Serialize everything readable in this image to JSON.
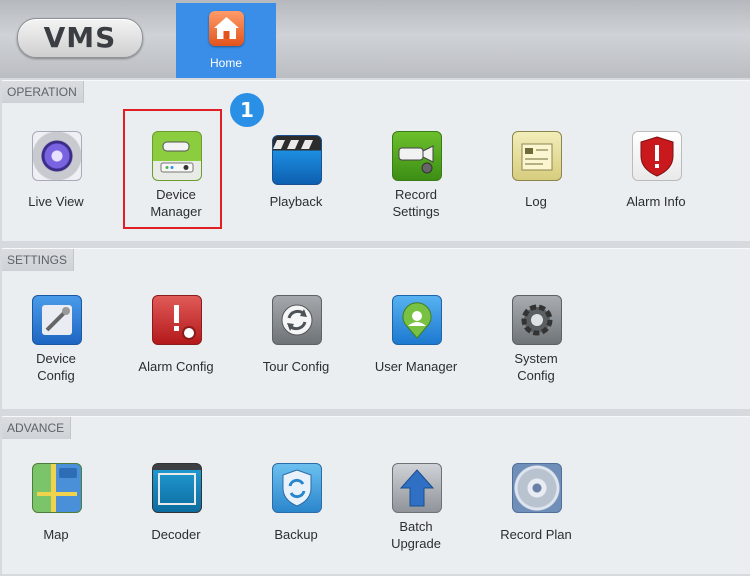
{
  "app": {
    "logo": "VMS"
  },
  "tabs": [
    {
      "label": "Home",
      "icon": "house-icon",
      "active": true
    }
  ],
  "sections": {
    "operation": {
      "title": "OPERATION",
      "items": [
        {
          "label": "Live View",
          "icon": "camera-lens-icon"
        },
        {
          "label": "Device\nManager",
          "icon": "device-manager-icon",
          "highlighted": true
        },
        {
          "label": "Playback",
          "icon": "clapperboard-icon"
        },
        {
          "label": "Record\nSettings",
          "icon": "record-settings-icon"
        },
        {
          "label": "Log",
          "icon": "log-book-icon"
        },
        {
          "label": "Alarm Info",
          "icon": "alarm-shield-icon"
        }
      ]
    },
    "settings": {
      "title": "SETTINGS",
      "items": [
        {
          "label": "Device\nConfig",
          "icon": "device-config-icon"
        },
        {
          "label": "Alarm Config",
          "icon": "alarm-config-icon"
        },
        {
          "label": "Tour Config",
          "icon": "tour-refresh-icon"
        },
        {
          "label": "User Manager",
          "icon": "user-manager-icon"
        },
        {
          "label": "System\nConfig",
          "icon": "system-gear-icon"
        }
      ]
    },
    "advance": {
      "title": "ADVANCE",
      "items": [
        {
          "label": "Map",
          "icon": "map-icon"
        },
        {
          "label": "Decoder",
          "icon": "decoder-monitor-icon"
        },
        {
          "label": "Backup",
          "icon": "backup-icon"
        },
        {
          "label": "Batch\nUpgrade",
          "icon": "upgrade-arrow-icon"
        },
        {
          "label": "Record Plan",
          "icon": "record-plan-disc-icon"
        }
      ]
    }
  },
  "annotation": {
    "step_number": "1"
  },
  "colors": {
    "accent": "#3a8ee8",
    "highlight_border": "#e01e24",
    "badge": "#2a90e6"
  }
}
